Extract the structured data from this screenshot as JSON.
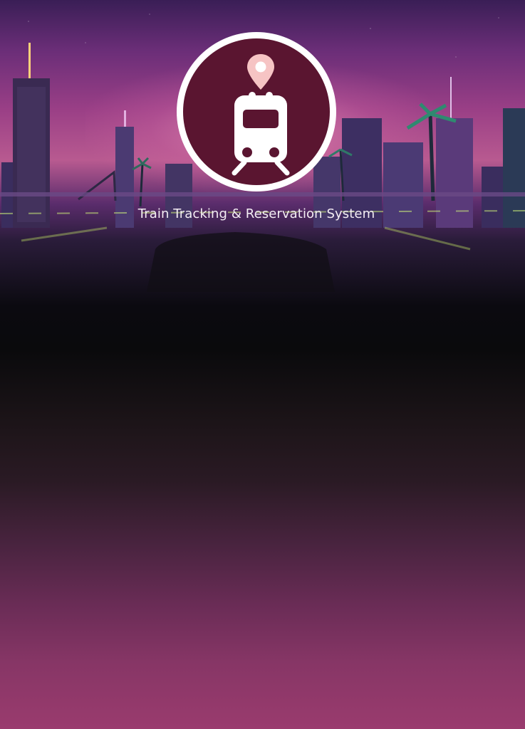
{
  "app": {
    "title": "Train Tracking & Reservation System"
  },
  "logo": {
    "icon_name": "train-location-icon",
    "circle_color": "#5a1530",
    "ring_color": "#ffffff",
    "pin_color": "#f6c4c4"
  },
  "background": {
    "scene": "neon-city-road",
    "gradient_top": "#9a3f86",
    "gradient_middle": "#0a0a0c",
    "gradient_bottom": "#9a3b6e"
  }
}
